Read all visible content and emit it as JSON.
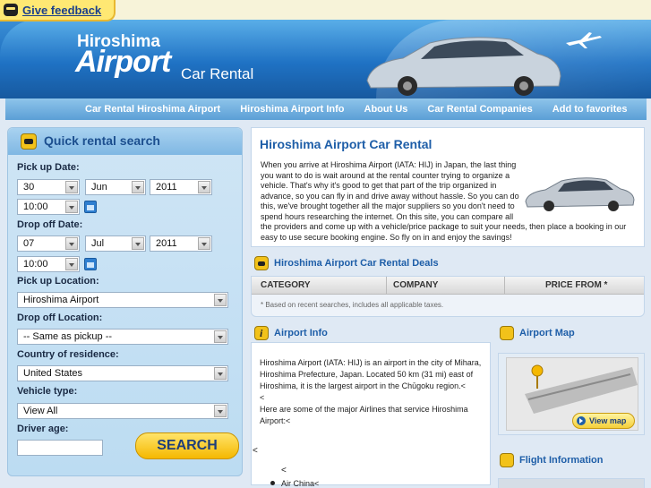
{
  "feedback": {
    "label": "Give feedback"
  },
  "brand": {
    "city": "Hiroshima",
    "airport": "Airport",
    "rental": "Car Rental"
  },
  "nav": {
    "items": [
      "Car Rental Hiroshima Airport",
      "Hiroshima Airport Info",
      "About Us",
      "Car Rental Companies",
      "Add to favorites"
    ]
  },
  "search": {
    "title": "Quick rental search",
    "pickup_date_label": "Pick up Date:",
    "pickup_day": "30",
    "pickup_month": "Jun",
    "pickup_year": "2011",
    "pickup_time": "10:00",
    "dropoff_date_label": "Drop off Date:",
    "dropoff_day": "07",
    "dropoff_month": "Jul",
    "dropoff_year": "2011",
    "dropoff_time": "10:00",
    "pickup_location_label": "Pick up Location:",
    "pickup_location": "Hiroshima Airport",
    "dropoff_location_label": "Drop off Location:",
    "dropoff_location": "-- Same as pickup --",
    "residence_label": "Country of residence:",
    "residence": "United States",
    "vehicle_label": "Vehicle type:",
    "vehicle": "View All",
    "driver_age_label": "Driver age:",
    "driver_age": "",
    "button": "SEARCH"
  },
  "intro": {
    "title": "Hiroshima Airport Car Rental",
    "text": "When you arrive at Hiroshima Airport (IATA: HIJ) in Japan, the last thing you want to do is wait around at the rental counter trying to organize a vehicle. That's why it's good to get that part of the trip organized in advance, so you can fly in and drive away without hassle. So you can do this, we've brought together all the major suppliers so you don't need to spend hours researching the internet. On this site, you can compare all the providers and come up with a vehicle/price package to suit your needs, then place a booking in our easy to use secure booking engine. So fly on in and enjoy the savings!"
  },
  "deals": {
    "title": "Hiroshima Airport Car Rental Deals",
    "columns": [
      "CATEGORY",
      "COMPANY",
      "PRICE FROM *"
    ],
    "note": "* Based on recent searches, includes all applicable taxes."
  },
  "airport_info": {
    "title": "Airport Info",
    "text1": "Hiroshima Airport (IATA: HIJ) is an airport in the city of Mihara, Hiroshima Prefecture, Japan. Located 50 km (31 mi) east of Hiroshima, it is the largest airport in the Chūgoku region.<",
    "text2": "<",
    "text3": "Here are some of the major Airlines that service Hiroshima Airport:<",
    "lt_left": "<",
    "lt_mid": "<",
    "airline1": "Air China<"
  },
  "airport_map": {
    "title": "Airport Map",
    "button": "View map"
  },
  "flight_info": {
    "title": "Flight Information"
  },
  "colors": {
    "brand_blue": "#1e6fc0",
    "accent_yellow": "#f5b800",
    "link_blue": "#1e5ea8"
  }
}
